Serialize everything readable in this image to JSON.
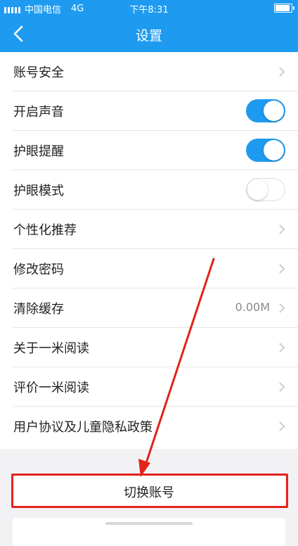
{
  "status_bar": {
    "carrier": "中国电信",
    "network": "4G",
    "time": "下午8:31"
  },
  "nav": {
    "title": "设置"
  },
  "settings": {
    "items": [
      {
        "label": "账号安全",
        "kind": "link"
      },
      {
        "label": "开启声音",
        "kind": "toggle",
        "on": true
      },
      {
        "label": "护眼提醒",
        "kind": "toggle",
        "on": true
      },
      {
        "label": "护眼模式",
        "kind": "toggle",
        "on": false
      },
      {
        "label": "个性化推荐",
        "kind": "link"
      },
      {
        "label": "修改密码",
        "kind": "link"
      },
      {
        "label": "清除缓存",
        "kind": "link",
        "value": "0.00M"
      },
      {
        "label": "关于一米阅读",
        "kind": "link"
      },
      {
        "label": "评价一米阅读",
        "kind": "link"
      },
      {
        "label": "用户协议及儿童隐私政策",
        "kind": "link"
      }
    ]
  },
  "actions": {
    "switch_account": "切换账号"
  },
  "colors": {
    "accent": "#1e9bf0",
    "highlight": "#e2231a"
  }
}
